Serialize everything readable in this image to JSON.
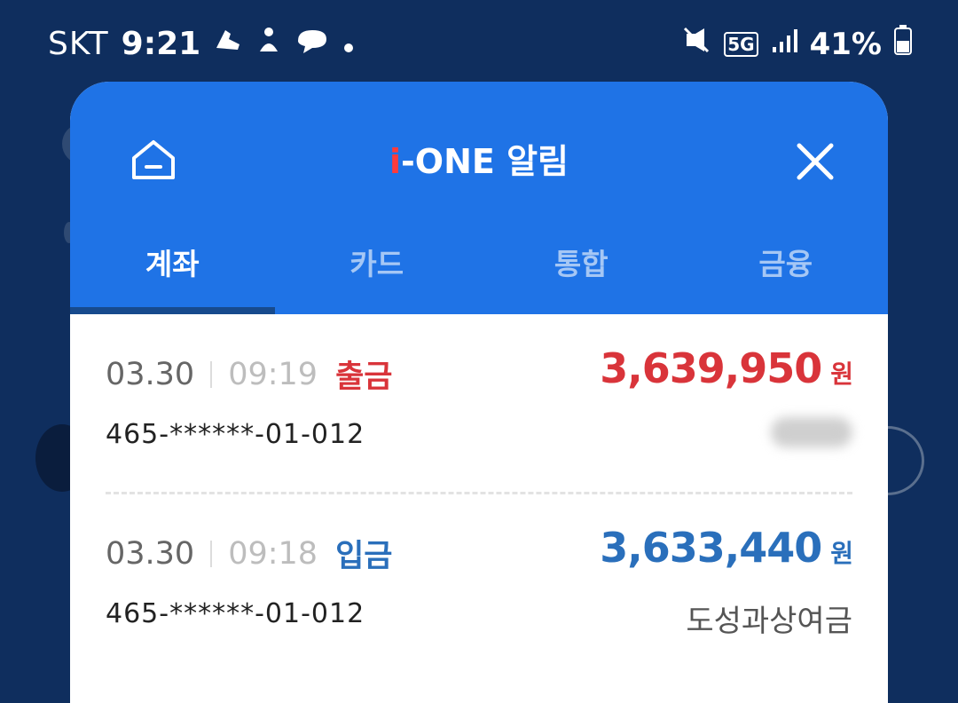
{
  "status_bar": {
    "carrier": "SKT",
    "time": "9:21",
    "network": "5G",
    "battery": "41%"
  },
  "modal": {
    "title_prefix": "i",
    "title_rest": "-ONE 알림",
    "tabs": [
      {
        "label": "계좌",
        "active": true
      },
      {
        "label": "카드",
        "active": false
      },
      {
        "label": "통합",
        "active": false
      },
      {
        "label": "금융",
        "active": false
      }
    ],
    "items": [
      {
        "date": "03.30",
        "time": "09:19",
        "kind": "출금",
        "amount": "3,639,950",
        "unit": "원",
        "account": "465-******-01-012",
        "memo": ""
      },
      {
        "date": "03.30",
        "time": "09:18",
        "kind": "입금",
        "amount": "3,633,440",
        "unit": "원",
        "account": "465-******-01-012",
        "memo": "도성과상여금"
      }
    ]
  },
  "colors": {
    "header_blue": "#1f73e6",
    "withdraw_red": "#d9343a",
    "deposit_blue": "#2a6fbb",
    "backdrop": "#0f2e5e"
  }
}
